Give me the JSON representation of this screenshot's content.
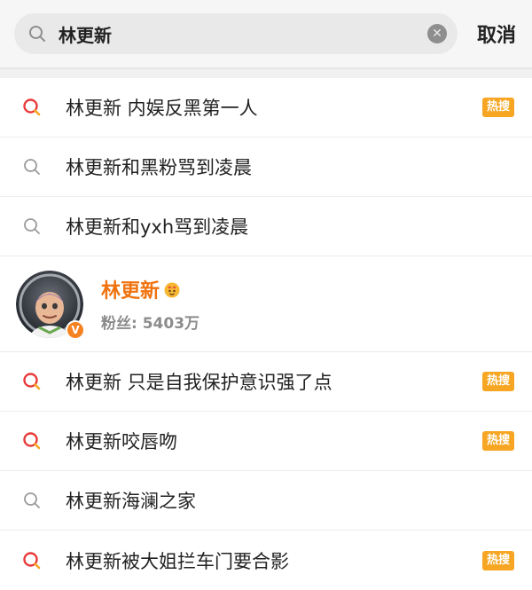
{
  "search": {
    "query": "林更新",
    "cancel_label": "取消"
  },
  "hot_label": "热搜",
  "suggestions_top": [
    {
      "text": "林更新 内娱反黑第一人",
      "hot": true
    },
    {
      "text": "林更新和黑粉骂到凌晨",
      "hot": false
    },
    {
      "text": "林更新和yxh骂到凌晨",
      "hot": false
    }
  ],
  "user": {
    "name": "林更新",
    "fans": "粉丝: 5403万",
    "verified_mark": "V"
  },
  "suggestions_bottom": [
    {
      "text": "林更新 只是自我保护意识强了点",
      "hot": true
    },
    {
      "text": "林更新咬唇吻",
      "hot": true
    },
    {
      "text": "林更新海澜之家",
      "hot": false
    },
    {
      "text": "林更新被大姐拦车门要合影",
      "hot": true
    }
  ],
  "colors": {
    "accent_orange": "#f0730f",
    "hot_badge": "#f6a623",
    "hot_search_icon": "#e83a3a"
  }
}
